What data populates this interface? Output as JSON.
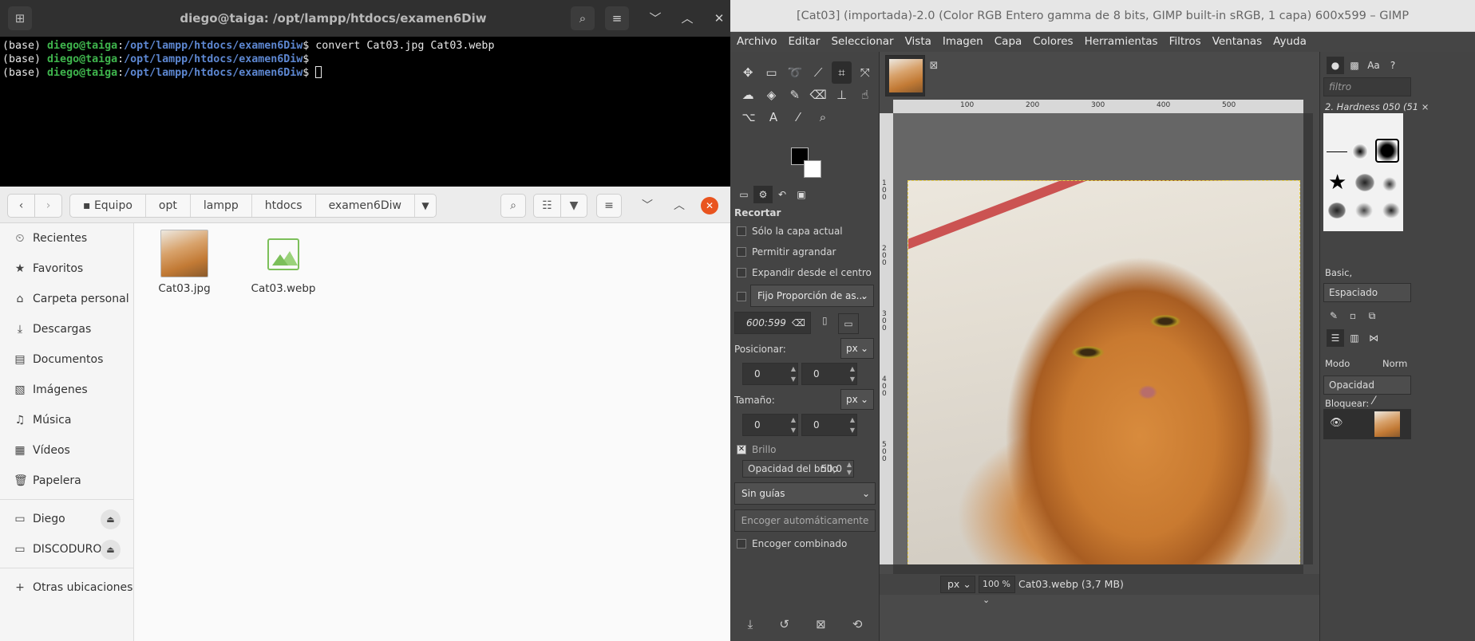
{
  "terminal": {
    "title": "diego@taiga: /opt/lampp/htdocs/examen6Diw",
    "lines": [
      {
        "env": "(base) ",
        "user": "diego@taiga",
        "sep": ":",
        "path": "/opt/lampp/htdocs/examen6Diw",
        "dollar": "$ ",
        "cmd": "convert Cat03.jpg Cat03.webp"
      },
      {
        "env": "(base) ",
        "user": "diego@taiga",
        "sep": ":",
        "path": "/opt/lampp/htdocs/examen6Diw",
        "dollar": "$ ",
        "cmd": ""
      },
      {
        "env": "(base) ",
        "user": "diego@taiga",
        "sep": ":",
        "path": "/opt/lampp/htdocs/examen6Diw",
        "dollar": "$ ",
        "cmd": ""
      }
    ]
  },
  "files": {
    "breadcrumb": [
      "Equipo",
      "opt",
      "lampp",
      "htdocs",
      "examen6Diw"
    ],
    "sidebar": [
      {
        "label": "Recientes",
        "icon": "⏲"
      },
      {
        "label": "Favoritos",
        "icon": "★"
      },
      {
        "label": "Carpeta personal",
        "icon": "⌂"
      },
      {
        "label": "Descargas",
        "icon": "⤓"
      },
      {
        "label": "Documentos",
        "icon": "▤"
      },
      {
        "label": "Imágenes",
        "icon": "▧"
      },
      {
        "label": "Música",
        "icon": "♫"
      },
      {
        "label": "Vídeos",
        "icon": "▦"
      },
      {
        "label": "Papelera",
        "icon": "🗑"
      }
    ],
    "devices": [
      {
        "label": "Diego",
        "icon": "▭"
      },
      {
        "label": "DISCODURO",
        "icon": "▭"
      }
    ],
    "other": {
      "label": "Otras ubicaciones",
      "icon": "+"
    },
    "items": [
      {
        "name": "Cat03.jpg"
      },
      {
        "name": "Cat03.webp"
      }
    ]
  },
  "gimp": {
    "title": "[Cat03] (importada)-2.0 (Color RGB Entero gamma de 8 bits, GIMP built-in sRGB, 1 capa) 600x599 – GIMP",
    "menu": [
      "Archivo",
      "Editar",
      "Seleccionar",
      "Vista",
      "Imagen",
      "Capa",
      "Colores",
      "Herramientas",
      "Filtros",
      "Ventanas",
      "Ayuda"
    ],
    "tool_options": {
      "title": "Recortar",
      "current_layer": "Sólo la capa actual",
      "allow_grow": "Permitir agrandar",
      "expand_center": "Expandir desde el centro",
      "fixed": "Fijo Proporción de as...",
      "ratio": "600:599",
      "position_label": "Posicionar:",
      "position_unit": "px",
      "pos_x": "0",
      "pos_y": "0",
      "size_label": "Tamaño:",
      "size_unit": "px",
      "size_x": "0",
      "size_y": "0",
      "highlight": "Brillo",
      "highlight_opacity_label": "Opacidad del brillo",
      "highlight_opacity_value": "50,0",
      "guides": "Sin guías",
      "auto_shrink": "Encoger automáticamente",
      "shrink_merged": "Encoger combinado"
    },
    "ruler_h": [
      "100",
      "200",
      "300",
      "400",
      "500"
    ],
    "ruler_v": [
      "1\n0\n0",
      "2\n0\n0",
      "3\n0\n0",
      "4\n0\n0",
      "5\n0\n0"
    ],
    "status": {
      "unit": "px",
      "zoom": "100 %",
      "file_info": "Cat03.webp (3,7 MB)"
    },
    "right": {
      "filter_placeholder": "filtro",
      "brush_name": "2. Hardness 050 (51 ×",
      "brush_tag": "Basic,",
      "spacing": "Espaciado",
      "mode_label": "Modo",
      "mode_value": "Norm",
      "opacity": "Opacidad",
      "lock": "Bloquear:"
    }
  }
}
